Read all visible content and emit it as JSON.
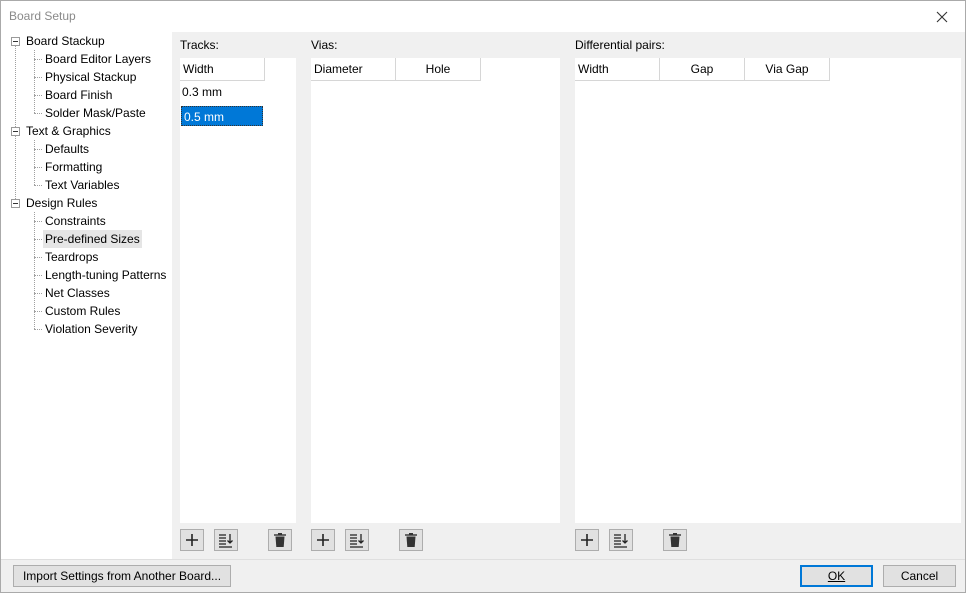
{
  "window": {
    "title": "Board Setup"
  },
  "icons": {
    "close": "close-icon",
    "add": "plus-icon",
    "sort": "sort-down-icon",
    "delete": "trash-icon"
  },
  "tree": {
    "groups": [
      {
        "label": "Board Stackup",
        "children": [
          "Board Editor Layers",
          "Physical Stackup",
          "Board Finish",
          "Solder Mask/Paste"
        ]
      },
      {
        "label": "Text & Graphics",
        "children": [
          "Defaults",
          "Formatting",
          "Text Variables"
        ]
      },
      {
        "label": "Design Rules",
        "children": [
          "Constraints",
          "Pre-defined Sizes",
          "Teardrops",
          "Length-tuning Patterns",
          "Net Classes",
          "Custom Rules",
          "Violation Severity"
        ]
      }
    ],
    "selected": "Pre-defined Sizes"
  },
  "tracks": {
    "label": "Tracks:",
    "columns": [
      "Width"
    ],
    "rows": [
      "0.3 mm",
      "0.5 mm"
    ],
    "selected_row": 1
  },
  "vias": {
    "label": "Vias:",
    "columns": [
      "Diameter",
      "Hole"
    ]
  },
  "diff_pairs": {
    "label": "Differential pairs:",
    "columns": [
      "Width",
      "Gap",
      "Via Gap"
    ]
  },
  "footer": {
    "import_label": "Import Settings from Another Board...",
    "ok_label": "OK",
    "cancel_label": "Cancel"
  }
}
